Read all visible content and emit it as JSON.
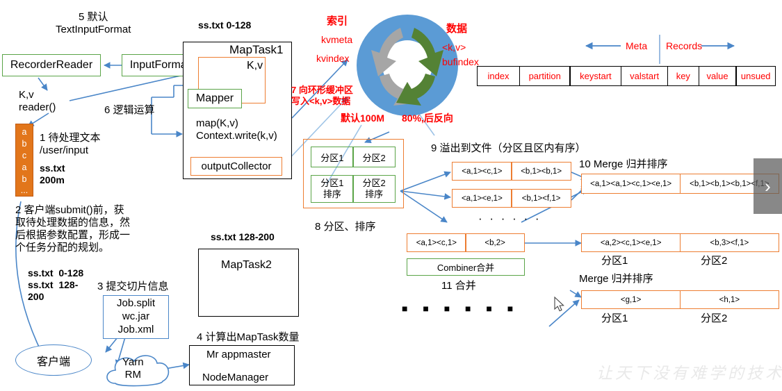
{
  "meta": {
    "watermark": "让天下没有难学的技术",
    "nav_next": "›"
  },
  "left": {
    "step5": "5 默认\nTextInputFormat",
    "recorder_reader": "RecorderReader",
    "input_format": "InputFormat",
    "kv_reader": "K,v\nreader()",
    "step6": "6 逻辑运算",
    "block_letters": [
      "a",
      "b",
      "c",
      "a",
      "b",
      "..."
    ],
    "step1": "1 待处理文本\n/user/input",
    "file_name": "ss.txt\n200m",
    "step2": "2 客户端submit()前，获\n取待处理数据的信息，然\n后根据参数配置，形成一\n个任务分配的规划。",
    "splits": "ss.txt  0-128\nss.txt  128-\n200",
    "step3": "3 提交切片信息",
    "job_files": "Job.split\nwc.jar\nJob.xml",
    "client": "客户端",
    "yarn_rm": "Yarn\nRM"
  },
  "maptask1": {
    "caption": "ss.txt 0-128",
    "title": "MapTask1",
    "kv": "K,v",
    "mapper": "Mapper",
    "map_call": "map(K,v)\nContext.write(k,v)",
    "output_collector": "outputCollector"
  },
  "maptask2": {
    "caption": "ss.txt 128-200",
    "title": "MapTask2",
    "step4": "4 计算出MapTask数量",
    "mr_appmaster": "Mr appmaster",
    "node_manager": "NodeManager"
  },
  "ring": {
    "step7": "7 向环形缓冲区\n写入<k,v>数据",
    "index_title": "索引",
    "kvmeta": "kvmeta",
    "kvindex": "kvindex",
    "data_title": "数据",
    "kv_label": "<k,v>",
    "bufindex": "bufindex",
    "default_size": "默认100M",
    "threshold": "80%,后反向"
  },
  "meta_table": {
    "meta_label": "Meta",
    "records_label": "Records",
    "columns": [
      "index",
      "partition",
      "keystart",
      "valstart",
      "key",
      "value",
      "unsued"
    ]
  },
  "partition_sort": {
    "row1": [
      "分区1",
      "分区2"
    ],
    "row2": [
      "分区1\n排序",
      "分区2\n排序"
    ],
    "caption": "8 分区、排序"
  },
  "spill": {
    "caption": "9 溢出到文件（分区且区内有序）",
    "file1": [
      "<a,1><c,1>",
      "<b,1><b,1>"
    ],
    "file2": [
      "<a,1><e,1>",
      "<b,1><f,1>"
    ],
    "ellipsis": "· · ·   · · ·"
  },
  "merge10": {
    "caption": "10 Merge 归并排序",
    "cells": [
      "<a,1><a,1><c,1><e,1>",
      "<b,1><b,1><b,1><f,1>"
    ]
  },
  "combine": {
    "cells": [
      "<a,1><c,1>",
      "<b,2>"
    ],
    "combiner": "Combiner合并",
    "caption": "11 合并"
  },
  "merge_right1": {
    "cells": [
      "<a,2><c,1><e,1>",
      "<b,3><f,1>"
    ],
    "labels": [
      "分区1",
      "分区2"
    ]
  },
  "merge_right2": {
    "caption": "Merge 归并排序",
    "cells": [
      "<g,1>",
      "<h,1>"
    ],
    "labels": [
      "分区1",
      "分区2"
    ]
  },
  "bottom_ellipsis": "■ ■ ■   ■ ■ ■",
  "colors": {
    "green": "#5aa447",
    "orange": "#ed7d31",
    "blue": "#4a86c8",
    "red": "#ff0000",
    "ringblue": "#5b9bd5",
    "ringgreen": "#548235",
    "ringgray": "#a6a6a6"
  }
}
